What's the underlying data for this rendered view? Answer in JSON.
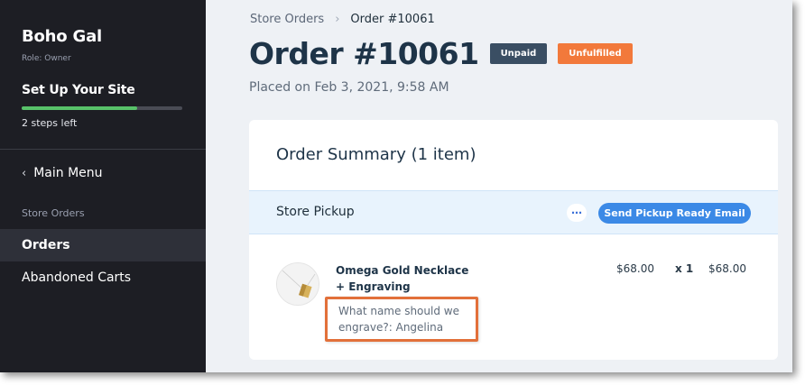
{
  "sidebar": {
    "site_name": "Boho Gal",
    "role": "Role: Owner",
    "setup_title": "Set Up Your Site",
    "setup_progress": 0.72,
    "steps_left": "2 steps left",
    "main_menu": "Main Menu",
    "section_label": "Store Orders",
    "items": [
      {
        "label": "Orders",
        "active": true
      },
      {
        "label": "Abandoned Carts",
        "active": false
      }
    ]
  },
  "breadcrumb": {
    "parent": "Store Orders",
    "current": "Order #10061"
  },
  "order": {
    "title": "Order #10061",
    "payment_status": "Unpaid",
    "fulfillment_status": "Unfulfilled",
    "placed_on": "Placed on Feb 3, 2021, 9:58 AM"
  },
  "summary": {
    "title": "Order Summary (1 item)",
    "pickup_label": "Store Pickup",
    "more_icon": "more-horizontal-icon",
    "send_button": "Send Pickup Ready Email",
    "item": {
      "name_line1": "Omega Gold Necklace",
      "name_line2": "+ Engraving",
      "option_text": "What name should we engrave?: Angelina",
      "unit_price": "$68.00",
      "quantity": "x 1",
      "total": "$68.00"
    }
  },
  "colors": {
    "sidebar_bg": "#1d1e24",
    "progress_fill": "#58c26a",
    "badge_unpaid": "#3a4e63",
    "badge_unfulfilled": "#f2793b",
    "primary_button": "#3b89e6",
    "highlight_box": "#e2703a"
  }
}
